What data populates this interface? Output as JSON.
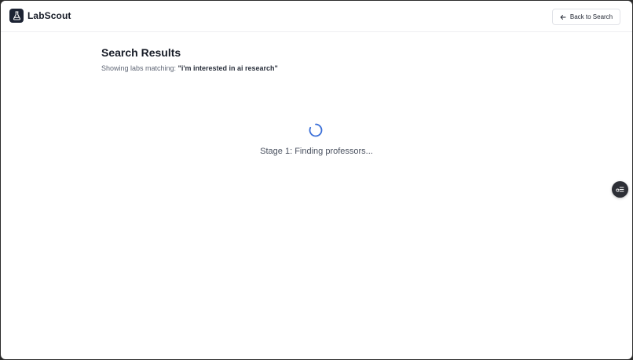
{
  "app": {
    "name": "LabScout",
    "logo_icon": "flask-icon"
  },
  "header": {
    "back_label": "Back to Search",
    "back_icon": "arrow-left-icon"
  },
  "main": {
    "title": "Search Results",
    "subtitle_prefix": "Showing labs matching: ",
    "query": "\"i'm interested in ai research\""
  },
  "loading": {
    "status": "Stage 1: Finding professors...",
    "spinner_color": "#3b6fd8"
  },
  "floating": {
    "icon": "settings-toggle-icon"
  },
  "colors": {
    "text_primary": "#161b26",
    "text_secondary": "#5f6675",
    "accent": "#3b6fd8",
    "logo_bg": "#1c2333"
  }
}
